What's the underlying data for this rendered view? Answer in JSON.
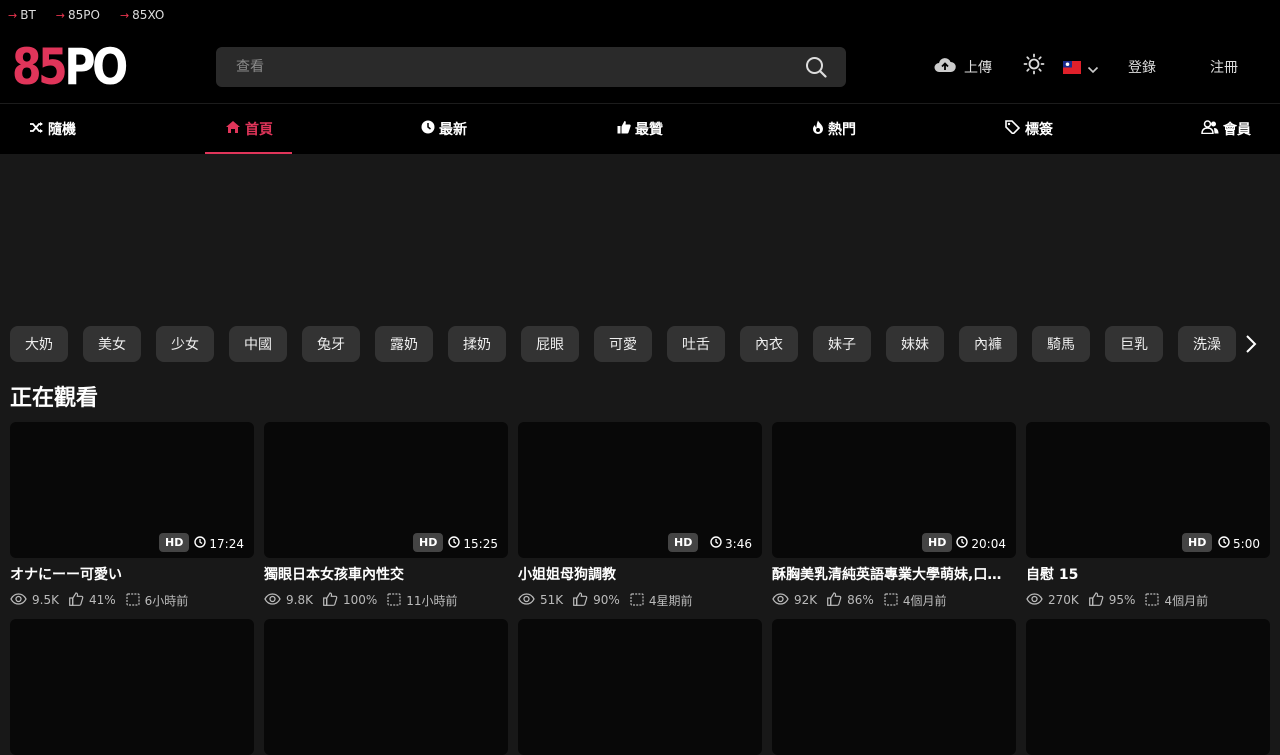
{
  "topbar": {
    "links": [
      "BT",
      "85PO",
      "85XO"
    ]
  },
  "logo": {
    "part1": "85",
    "part2": "PO"
  },
  "search": {
    "placeholder": "查看"
  },
  "header": {
    "upload_label": "上傳",
    "login_label": "登錄",
    "register_label": "注冊"
  },
  "nav": {
    "items": [
      "隨機",
      "首頁",
      "最新",
      "最贊",
      "熱門",
      "標簽",
      "會員"
    ]
  },
  "tags": [
    "大奶",
    "美女",
    "少女",
    "中國",
    "兔牙",
    "露奶",
    "揉奶",
    "屁眼",
    "可愛",
    "吐舌",
    "內衣",
    "妹子",
    "妹妹",
    "內褲",
    "騎馬",
    "巨乳",
    "洗澡"
  ],
  "section": {
    "title": "正在觀看"
  },
  "videos": [
    {
      "title": "オナにーー可愛い",
      "quality": "HD",
      "duration": "17:24",
      "views": "9.5K",
      "likes": "41%",
      "time": "6小時前"
    },
    {
      "title": "獨眼日本女孩車內性交",
      "quality": "HD",
      "duration": "15:25",
      "views": "9.8K",
      "likes": "100%",
      "time": "11小時前"
    },
    {
      "title": "小姐姐母狗調教",
      "quality": "HD",
      "duration": "3:46",
      "views": "51K",
      "likes": "90%",
      "time": "4星期前"
    },
    {
      "title": "酥胸美乳清純英語專業大學萌妹,口語...",
      "quality": "HD",
      "duration": "20:04",
      "views": "92K",
      "likes": "86%",
      "time": "4個月前"
    },
    {
      "title": "自慰 15",
      "quality": "HD",
      "duration": "5:00",
      "views": "270K",
      "likes": "95%",
      "time": "4個月前"
    }
  ],
  "colors": {
    "accent": "#e0355a",
    "background": "#181818",
    "bar": "#000000"
  }
}
